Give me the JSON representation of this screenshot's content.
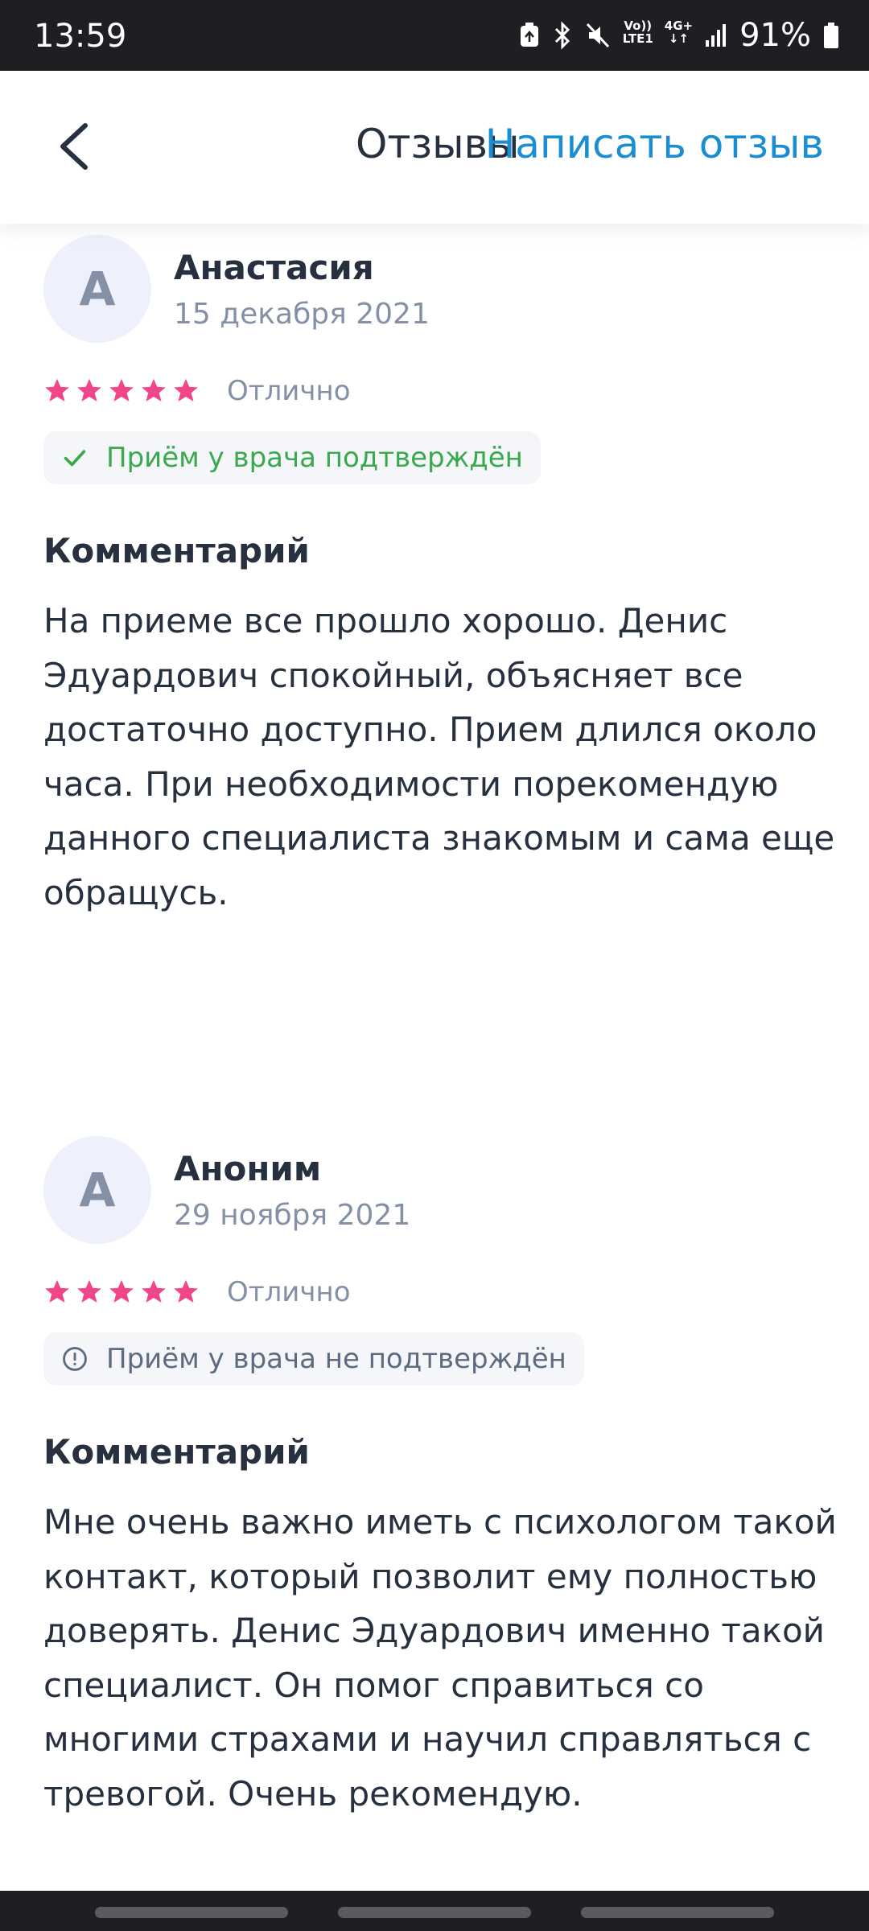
{
  "status_bar": {
    "time": "13:59",
    "network_top": "Vo))",
    "network_bottom": "LTE1",
    "gen_label": "4G+",
    "battery": "91%"
  },
  "header": {
    "title": "Отзывы",
    "action": "Написать отзыв"
  },
  "reviews": [
    {
      "avatar_letter": "А",
      "author": "Анастасия",
      "date": "15 декабря 2021",
      "stars": 5,
      "rating_label": "Отлично",
      "verification": "Приём у врача подтверждён",
      "comment_title": "Комментарий",
      "comment": "На приеме все прошло хорошо. Денис Эдуардович спокойный, объясняет все достаточно доступно. Прием длился около часа. При необходимости порекомендую данного специалиста знакомым и сама еще обращусь."
    },
    {
      "avatar_letter": "А",
      "author": "Аноним",
      "date": "29 ноября 2021",
      "stars": 5,
      "rating_label": "Отлично",
      "verification": "Приём у врача не подтверждён",
      "comment_title": "Комментарий",
      "comment": "Мне очень важно иметь с психологом такой контакт, который позволит ему полностью доверять. Денис Эдуардович именно такой специалист. Он помог справиться со многими страхами и научил справляться с тревогой. Очень рекомендую."
    }
  ],
  "colors": {
    "accent": "#1a8ed1",
    "star": "#f0468c",
    "verified": "#3aa84d",
    "unverified": "#5c6b80",
    "text": "#27303f",
    "muted": "#8390a6"
  }
}
